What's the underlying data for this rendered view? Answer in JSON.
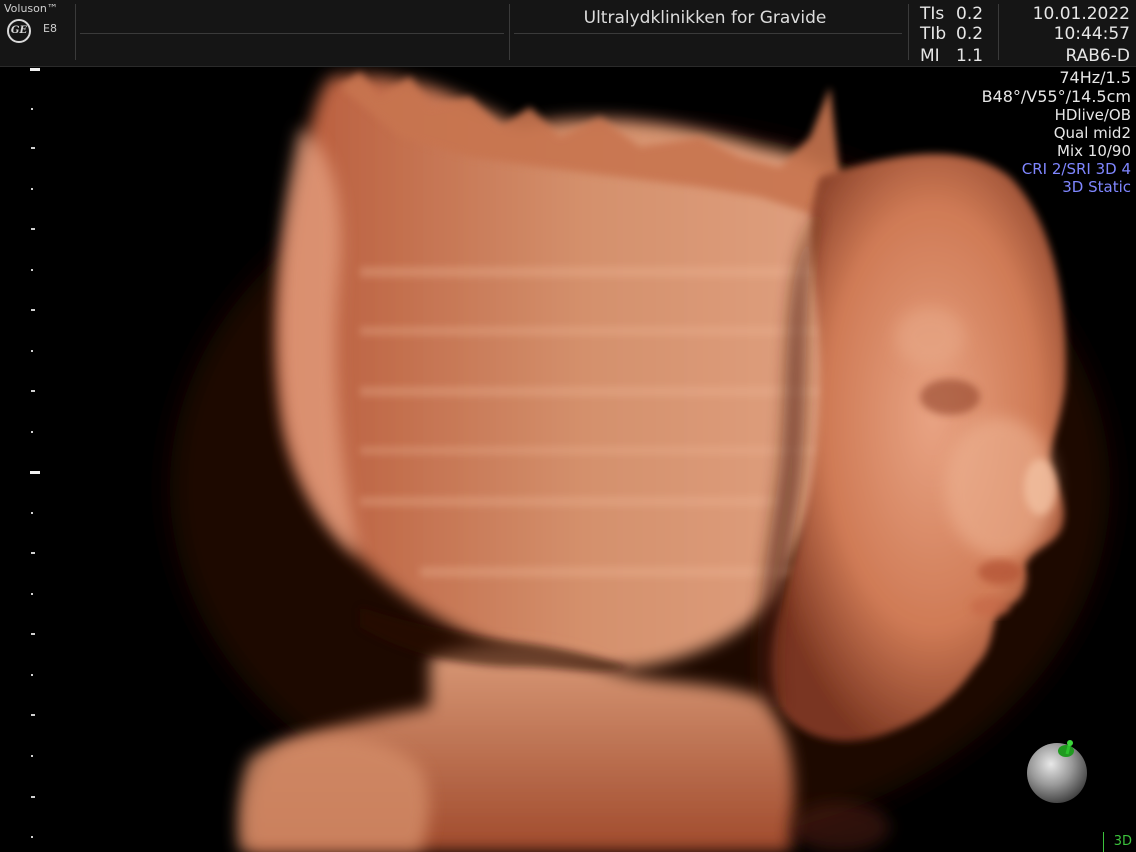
{
  "header": {
    "brand": "Voluson™",
    "logo": "GE",
    "model": "E8",
    "clinic": "Ultralydklinikken for Gravide",
    "params": [
      {
        "label": "TIs",
        "value": "0.2"
      },
      {
        "label": "TIb",
        "value": "0.2"
      },
      {
        "label": "MI",
        "value": "1.1"
      }
    ],
    "date": "10.01.2022",
    "time": "10:44:57",
    "probe": "RAB6-D"
  },
  "acquisition": {
    "frame_rate": "74Hz/1.5",
    "geometry": "B48°/V55°/14.5cm",
    "mode": "HDlive/OB",
    "quality": "Qual mid2",
    "mix": "Mix 10/90",
    "cri_sri": "CRI 2/SRI 3D 4",
    "status": "3D Static"
  },
  "view_mode": "3D",
  "icons": {
    "orientation": "orientation-ball-icon",
    "logo": "ge-logo-icon"
  },
  "colors": {
    "header_bg": "#151515",
    "tissue": "#c8734e",
    "tissue_highlight": "#eab08e",
    "status_blue": "#7f86ff",
    "indicator_green": "#3cc23c"
  }
}
